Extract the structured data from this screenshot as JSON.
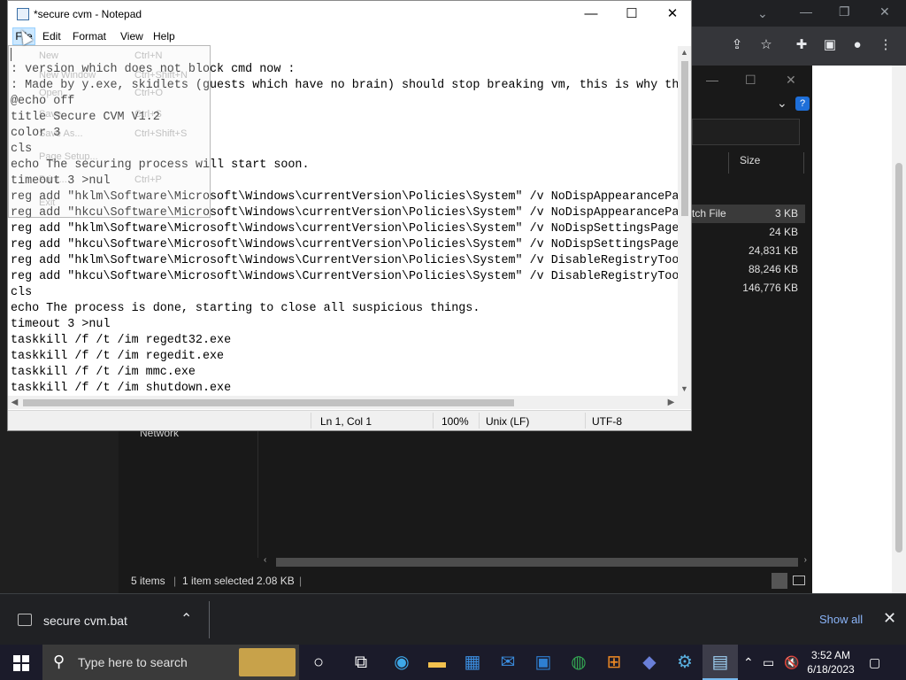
{
  "notepad": {
    "title": "*secure cvm - Notepad",
    "menu": {
      "file": "File",
      "edit": "Edit",
      "format": "Format",
      "view": "View",
      "help": "Help"
    },
    "lines": [
      "",
      ": version which does not block cmd now :",
      ": Made by y.exe, skidlets (guests which have no brain) should stop breaking vm, this is why th",
      "@echo off",
      "title Secure CVM V1.2",
      "color 3",
      "cls",
      "echo The securing process will start soon.",
      "timeout 3 >nul",
      "reg add \"hklm\\Software\\Microsoft\\Windows\\currentVersion\\Policies\\System\" /v NoDispAppearancePa",
      "reg add \"hkcu\\Software\\Microsoft\\Windows\\currentVersion\\Policies\\System\" /v NoDispAppearancePa",
      "reg add \"hklm\\Software\\Microsoft\\Windows\\currentVersion\\Policies\\System\" /v NoDispSettingsPage",
      "reg add \"hkcu\\Software\\Microsoft\\Windows\\currentVersion\\Policies\\System\" /v NoDispSettingsPage",
      "reg add \"hklm\\Software\\Microsoft\\Windows\\CurrentVersion\\Policies\\System\" /v DisableRegistryToo",
      "reg add \"hkcu\\Software\\Microsoft\\Windows\\CurrentVersion\\Policies\\System\" /v DisableRegistryToo",
      "cls",
      "echo The process is done, starting to close all suspicious things.",
      "timeout 3 >nul",
      "taskkill /f /t /im regedt32.exe",
      "taskkill /f /t /im regedit.exe",
      "taskkill /f /t /im mmc.exe",
      "taskkill /f /t /im shutdown.exe"
    ],
    "status": {
      "position": "Ln 1, Col 1",
      "zoom": "100%",
      "line_ending": "Unix (LF)",
      "encoding": "UTF-8"
    },
    "file_menu": [
      {
        "label": "New",
        "shortcut": "Ctrl+N"
      },
      {
        "label": "New Window",
        "shortcut": "Ctrl+Shift+N"
      },
      {
        "label": "Open...",
        "shortcut": "Ctrl+O"
      },
      {
        "label": "Save",
        "shortcut": "Ctrl+S"
      },
      {
        "label": "Save As...",
        "shortcut": "Ctrl+Shift+S"
      },
      {
        "label": "Page Setup...",
        "shortcut": ""
      },
      {
        "label": "Print...",
        "shortcut": "Ctrl+P"
      },
      {
        "label": "Exit",
        "shortcut": ""
      }
    ]
  },
  "explorer": {
    "column_size": "Size",
    "rows": [
      {
        "type": "tch File",
        "size": "3 KB",
        "selected": true
      },
      {
        "type": "",
        "size": "24 KB",
        "selected": false
      },
      {
        "type": "",
        "size": "24,831 KB",
        "selected": false
      },
      {
        "type": "",
        "size": "88,246 KB",
        "selected": false
      },
      {
        "type": "",
        "size": "146,776 KB",
        "selected": false
      }
    ],
    "nav_network": "Network",
    "status_items": "5 items",
    "status_selected": "1 item selected  2.08 KB"
  },
  "download_bar": {
    "file_name": "secure cvm.bat",
    "show_all": "Show all"
  },
  "taskbar": {
    "search_placeholder": "Type here to search",
    "time": "3:52 AM",
    "date": "6/18/2023"
  }
}
